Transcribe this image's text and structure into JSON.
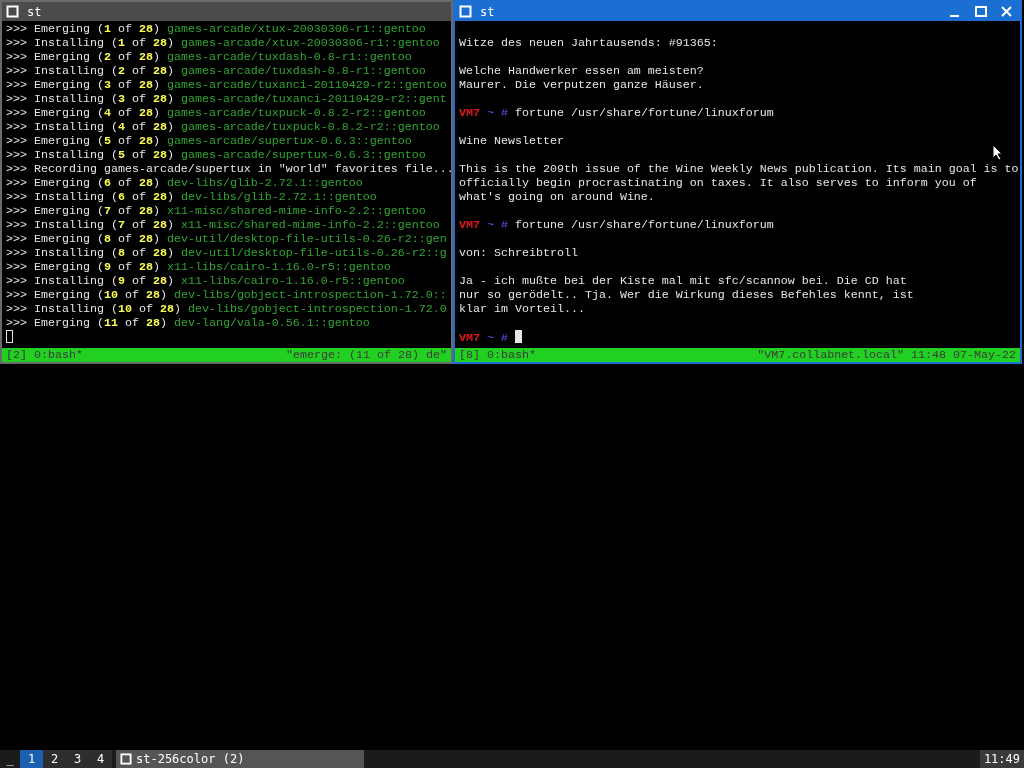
{
  "windows": [
    {
      "title": "st",
      "active": false,
      "lines": [
        {
          "kind": "text",
          "segments": [
            {
              "kind": "plain",
              "text": ">>> Emerging ("
            },
            {
              "kind": "count",
              "text": "1"
            },
            {
              "kind": "plain",
              "text": " of "
            },
            {
              "kind": "count",
              "text": "28"
            },
            {
              "kind": "plain",
              "text": ") "
            },
            {
              "kind": "package",
              "text": "games-arcade/xtux-20030306-r1::gentoo"
            }
          ]
        },
        {
          "kind": "text",
          "segments": [
            {
              "kind": "plain",
              "text": ">>> Installing ("
            },
            {
              "kind": "count",
              "text": "1"
            },
            {
              "kind": "plain",
              "text": " of "
            },
            {
              "kind": "count",
              "text": "28"
            },
            {
              "kind": "plain",
              "text": ") "
            },
            {
              "kind": "package",
              "text": "games-arcade/xtux-20030306-r1::gentoo"
            }
          ]
        },
        {
          "kind": "text",
          "segments": [
            {
              "kind": "plain",
              "text": ">>> Emerging ("
            },
            {
              "kind": "count",
              "text": "2"
            },
            {
              "kind": "plain",
              "text": " of "
            },
            {
              "kind": "count",
              "text": "28"
            },
            {
              "kind": "plain",
              "text": ") "
            },
            {
              "kind": "package",
              "text": "games-arcade/tuxdash-0.8-r1::gentoo"
            }
          ]
        },
        {
          "kind": "text",
          "segments": [
            {
              "kind": "plain",
              "text": ">>> Installing ("
            },
            {
              "kind": "count",
              "text": "2"
            },
            {
              "kind": "plain",
              "text": " of "
            },
            {
              "kind": "count",
              "text": "28"
            },
            {
              "kind": "plain",
              "text": ") "
            },
            {
              "kind": "package",
              "text": "games-arcade/tuxdash-0.8-r1::gentoo"
            }
          ]
        },
        {
          "kind": "text",
          "segments": [
            {
              "kind": "plain",
              "text": ">>> Emerging ("
            },
            {
              "kind": "count",
              "text": "3"
            },
            {
              "kind": "plain",
              "text": " of "
            },
            {
              "kind": "count",
              "text": "28"
            },
            {
              "kind": "plain",
              "text": ") "
            },
            {
              "kind": "package",
              "text": "games-arcade/tuxanci-20110429-r2::gentoo"
            }
          ]
        },
        {
          "kind": "text",
          "segments": [
            {
              "kind": "plain",
              "text": ">>> Installing ("
            },
            {
              "kind": "count",
              "text": "3"
            },
            {
              "kind": "plain",
              "text": " of "
            },
            {
              "kind": "count",
              "text": "28"
            },
            {
              "kind": "plain",
              "text": ") "
            },
            {
              "kind": "package",
              "text": "games-arcade/tuxanci-20110429-r2::gent"
            }
          ]
        },
        {
          "kind": "text",
          "segments": [
            {
              "kind": "plain",
              "text": ">>> Emerging ("
            },
            {
              "kind": "count",
              "text": "4"
            },
            {
              "kind": "plain",
              "text": " of "
            },
            {
              "kind": "count",
              "text": "28"
            },
            {
              "kind": "plain",
              "text": ") "
            },
            {
              "kind": "package",
              "text": "games-arcade/tuxpuck-0.8.2-r2::gentoo"
            }
          ]
        },
        {
          "kind": "text",
          "segments": [
            {
              "kind": "plain",
              "text": ">>> Installing ("
            },
            {
              "kind": "count",
              "text": "4"
            },
            {
              "kind": "plain",
              "text": " of "
            },
            {
              "kind": "count",
              "text": "28"
            },
            {
              "kind": "plain",
              "text": ") "
            },
            {
              "kind": "package",
              "text": "games-arcade/tuxpuck-0.8.2-r2::gentoo"
            }
          ]
        },
        {
          "kind": "text",
          "segments": [
            {
              "kind": "plain",
              "text": ">>> Emerging ("
            },
            {
              "kind": "count",
              "text": "5"
            },
            {
              "kind": "plain",
              "text": " of "
            },
            {
              "kind": "count",
              "text": "28"
            },
            {
              "kind": "plain",
              "text": ") "
            },
            {
              "kind": "package",
              "text": "games-arcade/supertux-0.6.3::gentoo"
            }
          ]
        },
        {
          "kind": "text",
          "segments": [
            {
              "kind": "plain",
              "text": ">>> Installing ("
            },
            {
              "kind": "count",
              "text": "5"
            },
            {
              "kind": "plain",
              "text": " of "
            },
            {
              "kind": "count",
              "text": "28"
            },
            {
              "kind": "plain",
              "text": ") "
            },
            {
              "kind": "package",
              "text": "games-arcade/supertux-0.6.3::gentoo"
            }
          ]
        },
        {
          "kind": "text",
          "segments": [
            {
              "kind": "plain",
              "text": ">>> Recording games-arcade/supertux in \"world\" favorites file..."
            }
          ]
        },
        {
          "kind": "text",
          "segments": [
            {
              "kind": "plain",
              "text": ">>> Emerging ("
            },
            {
              "kind": "count",
              "text": "6"
            },
            {
              "kind": "plain",
              "text": " of "
            },
            {
              "kind": "count",
              "text": "28"
            },
            {
              "kind": "plain",
              "text": ") "
            },
            {
              "kind": "package",
              "text": "dev-libs/glib-2.72.1::gentoo"
            }
          ]
        },
        {
          "kind": "text",
          "segments": [
            {
              "kind": "plain",
              "text": ">>> Installing ("
            },
            {
              "kind": "count",
              "text": "6"
            },
            {
              "kind": "plain",
              "text": " of "
            },
            {
              "kind": "count",
              "text": "28"
            },
            {
              "kind": "plain",
              "text": ") "
            },
            {
              "kind": "package",
              "text": "dev-libs/glib-2.72.1::gentoo"
            }
          ]
        },
        {
          "kind": "text",
          "segments": [
            {
              "kind": "plain",
              "text": ">>> Emerging ("
            },
            {
              "kind": "count",
              "text": "7"
            },
            {
              "kind": "plain",
              "text": " of "
            },
            {
              "kind": "count",
              "text": "28"
            },
            {
              "kind": "plain",
              "text": ") "
            },
            {
              "kind": "package",
              "text": "x11-misc/shared-mime-info-2.2::gentoo"
            }
          ]
        },
        {
          "kind": "text",
          "segments": [
            {
              "kind": "plain",
              "text": ">>> Installing ("
            },
            {
              "kind": "count",
              "text": "7"
            },
            {
              "kind": "plain",
              "text": " of "
            },
            {
              "kind": "count",
              "text": "28"
            },
            {
              "kind": "plain",
              "text": ") "
            },
            {
              "kind": "package",
              "text": "x11-misc/shared-mime-info-2.2::gentoo"
            }
          ]
        },
        {
          "kind": "text",
          "segments": [
            {
              "kind": "plain",
              "text": ">>> Emerging ("
            },
            {
              "kind": "count",
              "text": "8"
            },
            {
              "kind": "plain",
              "text": " of "
            },
            {
              "kind": "count",
              "text": "28"
            },
            {
              "kind": "plain",
              "text": ") "
            },
            {
              "kind": "package",
              "text": "dev-util/desktop-file-utils-0.26-r2::gen"
            }
          ]
        },
        {
          "kind": "text",
          "segments": [
            {
              "kind": "plain",
              "text": ">>> Installing ("
            },
            {
              "kind": "count",
              "text": "8"
            },
            {
              "kind": "plain",
              "text": " of "
            },
            {
              "kind": "count",
              "text": "28"
            },
            {
              "kind": "plain",
              "text": ") "
            },
            {
              "kind": "package",
              "text": "dev-util/desktop-file-utils-0.26-r2::g"
            }
          ]
        },
        {
          "kind": "text",
          "segments": [
            {
              "kind": "plain",
              "text": ">>> Emerging ("
            },
            {
              "kind": "count",
              "text": "9"
            },
            {
              "kind": "plain",
              "text": " of "
            },
            {
              "kind": "count",
              "text": "28"
            },
            {
              "kind": "plain",
              "text": ") "
            },
            {
              "kind": "package",
              "text": "x11-libs/cairo-1.16.0-r5::gentoo"
            }
          ]
        },
        {
          "kind": "text",
          "segments": [
            {
              "kind": "plain",
              "text": ">>> Installing ("
            },
            {
              "kind": "count",
              "text": "9"
            },
            {
              "kind": "plain",
              "text": " of "
            },
            {
              "kind": "count",
              "text": "28"
            },
            {
              "kind": "plain",
              "text": ") "
            },
            {
              "kind": "package",
              "text": "x11-libs/cairo-1.16.0-r5::gentoo"
            }
          ]
        },
        {
          "kind": "text",
          "segments": [
            {
              "kind": "plain",
              "text": ">>> Emerging ("
            },
            {
              "kind": "count",
              "text": "10"
            },
            {
              "kind": "plain",
              "text": " of "
            },
            {
              "kind": "count",
              "text": "28"
            },
            {
              "kind": "plain",
              "text": ") "
            },
            {
              "kind": "package",
              "text": "dev-libs/gobject-introspection-1.72.0::"
            }
          ]
        },
        {
          "kind": "text",
          "segments": [
            {
              "kind": "plain",
              "text": ">>> Installing ("
            },
            {
              "kind": "count",
              "text": "10"
            },
            {
              "kind": "plain",
              "text": " of "
            },
            {
              "kind": "count",
              "text": "28"
            },
            {
              "kind": "plain",
              "text": ") "
            },
            {
              "kind": "package",
              "text": "dev-libs/gobject-introspection-1.72.0"
            }
          ]
        },
        {
          "kind": "text",
          "segments": [
            {
              "kind": "plain",
              "text": ">>> Emerging ("
            },
            {
              "kind": "count",
              "text": "11"
            },
            {
              "kind": "plain",
              "text": " of "
            },
            {
              "kind": "count",
              "text": "28"
            },
            {
              "kind": "plain",
              "text": ") "
            },
            {
              "kind": "package",
              "text": "dev-lang/vala-0.56.1::gentoo"
            }
          ]
        },
        {
          "kind": "cursor",
          "cursor": true
        }
      ],
      "status": {
        "left": "[2] 0:bash*",
        "right": "\"emerge: (11 of 28) de\""
      }
    },
    {
      "title": "st",
      "active": true,
      "lines": [
        {
          "kind": "blank"
        },
        {
          "kind": "text",
          "segments": [
            {
              "kind": "plain",
              "text": "Witze des neuen Jahrtausends: #91365:"
            }
          ]
        },
        {
          "kind": "blank"
        },
        {
          "kind": "text",
          "segments": [
            {
              "kind": "plain",
              "text": "Welche Handwerker essen am meisten?"
            }
          ]
        },
        {
          "kind": "text",
          "segments": [
            {
              "kind": "plain",
              "text": "Maurer. Die verputzen ganze Häuser."
            }
          ]
        },
        {
          "kind": "blank"
        },
        {
          "kind": "text",
          "segments": [
            {
              "kind": "host",
              "text": "VM7"
            },
            {
              "kind": "path",
              "text": " ~ # "
            },
            {
              "kind": "plain",
              "text": "fortune /usr/share/fortune/linuxforum"
            }
          ]
        },
        {
          "kind": "blank"
        },
        {
          "kind": "text",
          "segments": [
            {
              "kind": "plain",
              "text": "Wine Newsletter"
            }
          ]
        },
        {
          "kind": "blank"
        },
        {
          "kind": "text",
          "segments": [
            {
              "kind": "plain",
              "text": "This is the 209th issue of the Wine Weekly News publication. Its main goal is to"
            }
          ]
        },
        {
          "kind": "text",
          "segments": [
            {
              "kind": "plain",
              "text": "officially begin procrastinating on taxes. It also serves to inform you of"
            }
          ]
        },
        {
          "kind": "text",
          "segments": [
            {
              "kind": "plain",
              "text": "what's going on around Wine."
            }
          ]
        },
        {
          "kind": "blank"
        },
        {
          "kind": "text",
          "segments": [
            {
              "kind": "host",
              "text": "VM7"
            },
            {
              "kind": "path",
              "text": " ~ # "
            },
            {
              "kind": "plain",
              "text": "fortune /usr/share/fortune/linuxforum"
            }
          ]
        },
        {
          "kind": "blank"
        },
        {
          "kind": "text",
          "segments": [
            {
              "kind": "plain",
              "text": "von: Schreibtroll"
            }
          ]
        },
        {
          "kind": "blank"
        },
        {
          "kind": "text",
          "segments": [
            {
              "kind": "plain",
              "text": "Ja - ich mußte bei der Kiste mal mit sfc/scannow bei. Die CD hat"
            }
          ]
        },
        {
          "kind": "text",
          "segments": [
            {
              "kind": "plain",
              "text": "nur so gerödelt.. Tja. Wer die Wirkung dieses Befehles kennt, ist"
            }
          ]
        },
        {
          "kind": "text",
          "segments": [
            {
              "kind": "plain",
              "text": "klar im Vorteil..."
            }
          ]
        },
        {
          "kind": "blank"
        },
        {
          "kind": "text",
          "cursor": true,
          "segments": [
            {
              "kind": "host",
              "text": "VM7"
            },
            {
              "kind": "path",
              "text": " ~ #"
            }
          ]
        }
      ],
      "status": {
        "left": "[8] 0:bash*",
        "right": "\"VM7.collabnet.local\" 11:48 07-May-22"
      }
    }
  ],
  "taskbar": {
    "show_desktop": "_",
    "workspaces": [
      {
        "label": "1",
        "selected": true
      },
      {
        "label": "2",
        "selected": false
      },
      {
        "label": "3",
        "selected": false
      },
      {
        "label": "4",
        "selected": false
      }
    ],
    "tasks": [
      {
        "label": "st-256color (2)"
      }
    ],
    "clock": "11:49"
  }
}
